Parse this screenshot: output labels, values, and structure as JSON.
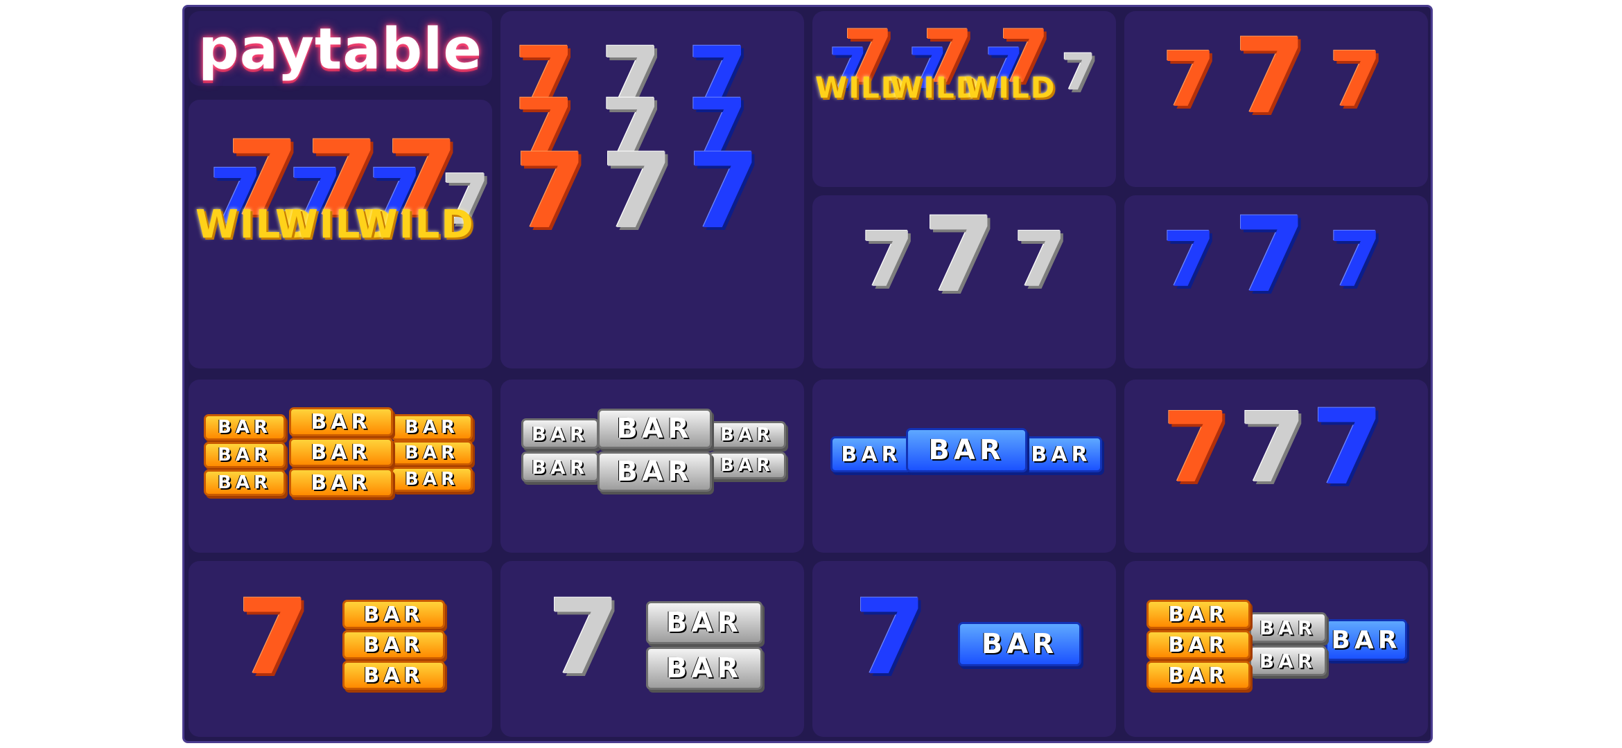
{
  "paytable": {
    "title": "paytable",
    "wild_label": "WILD",
    "seven_glyph": "7",
    "bar_label": "BAR"
  },
  "colors": {
    "board_bg": "#23194f",
    "cell_bg": "#2e1f63",
    "seven_red": "#ff5a1c",
    "seven_gray": "#cfcfcf",
    "seven_blue": "#1f3cff",
    "bar_orange": "#ff8a00",
    "bar_silver": "#c8c8c8",
    "bar_blue": "#1b52ff",
    "wild_gold": "#ffd21a"
  }
}
